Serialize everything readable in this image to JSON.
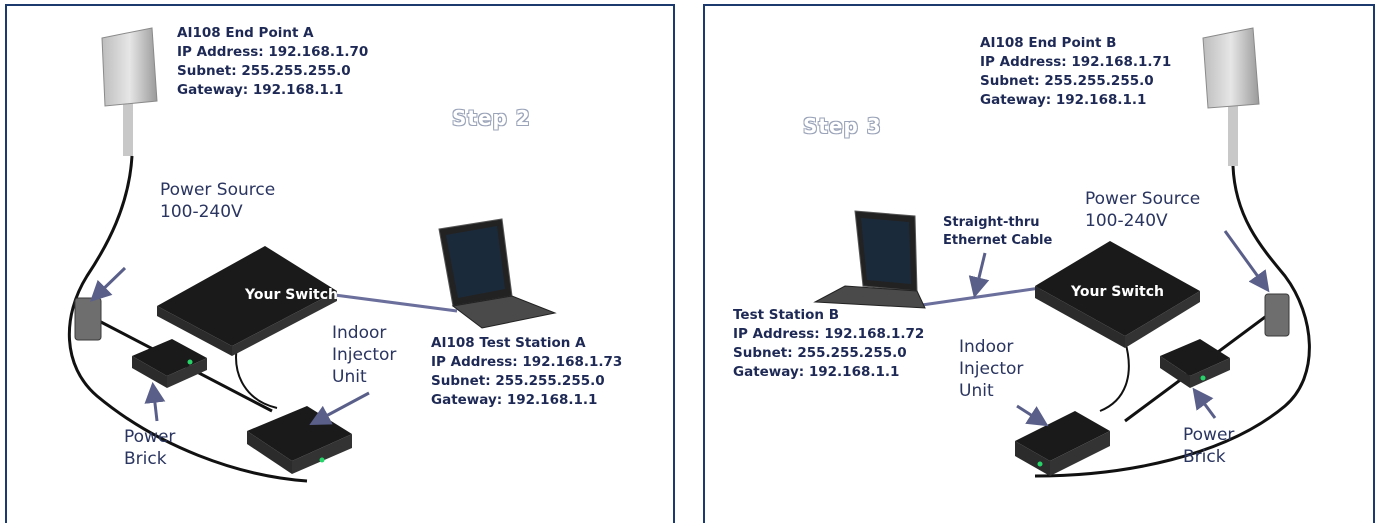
{
  "panel_a": {
    "endpoint": {
      "name": "AI108 End Point A",
      "ip": "IP Address: 192.168.1.70",
      "subnet": "Subnet: 255.255.255.0",
      "gateway": "Gateway: 192.168.1.1"
    },
    "step": "Step 2",
    "power_source": [
      "Power Source",
      "100-240V"
    ],
    "switch_label": "Your Switch",
    "injector": [
      "Indoor",
      "Injector",
      "Unit"
    ],
    "power_brick": [
      "Power",
      "Brick"
    ],
    "test_station": {
      "name": "AI108 Test Station A",
      "ip": "IP Address: 192.168.1.73",
      "subnet": "Subnet: 255.255.255.0",
      "gateway": "Gateway: 192.168.1.1"
    }
  },
  "panel_b": {
    "endpoint": {
      "name": "AI108 End Point B",
      "ip": "IP Address: 192.168.1.71",
      "subnet": "Subnet: 255.255.255.0",
      "gateway": "Gateway: 192.168.1.1"
    },
    "step": "Step 3",
    "power_source": [
      "Power Source",
      "100-240V"
    ],
    "cable": [
      "Straight-thru",
      "Ethernet Cable"
    ],
    "switch_label": "Your Switch",
    "injector": [
      "Indoor",
      "Injector",
      "Unit"
    ],
    "power_brick": [
      "Power",
      "Brick"
    ],
    "test_station": {
      "name": "Test Station B",
      "ip": "IP Address: 192.168.1.72",
      "subnet": "Subnet: 255.255.255.0",
      "gateway": "Gateway: 192.168.1.1"
    }
  },
  "colors": {
    "border": "#1c3a6e",
    "text": "#1e2a55",
    "arrow": "#5a5f8a"
  }
}
